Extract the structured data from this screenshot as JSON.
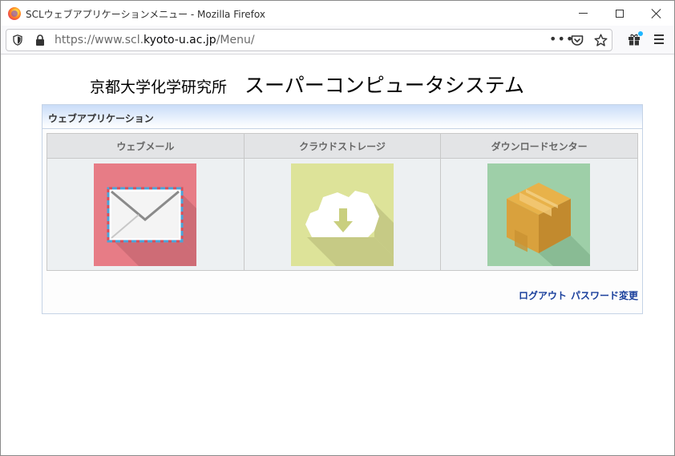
{
  "window": {
    "title": "SCLウェブアプリケーションメニュー - Mozilla Firefox"
  },
  "navbar": {
    "url_prefix": "https://www.scl.",
    "url_domain": "kyoto-u.ac.jp",
    "url_path": "/Menu/",
    "more_label": "•••"
  },
  "header": {
    "institute": "京都大学化学研究所",
    "system": "スーパーコンピュータシステム"
  },
  "panel": {
    "title": "ウェブアプリケーション",
    "apps": [
      {
        "label": "ウェブメール",
        "icon": "envelope-icon",
        "color": "#e77c86"
      },
      {
        "label": "クラウドストレージ",
        "icon": "cloud-download-icon",
        "color": "#dde399"
      },
      {
        "label": "ダウンロードセンター",
        "icon": "package-icon",
        "color": "#9ecfa8"
      }
    ]
  },
  "footer": {
    "logout_label": "ログアウト",
    "password_label": "パスワード変更"
  }
}
